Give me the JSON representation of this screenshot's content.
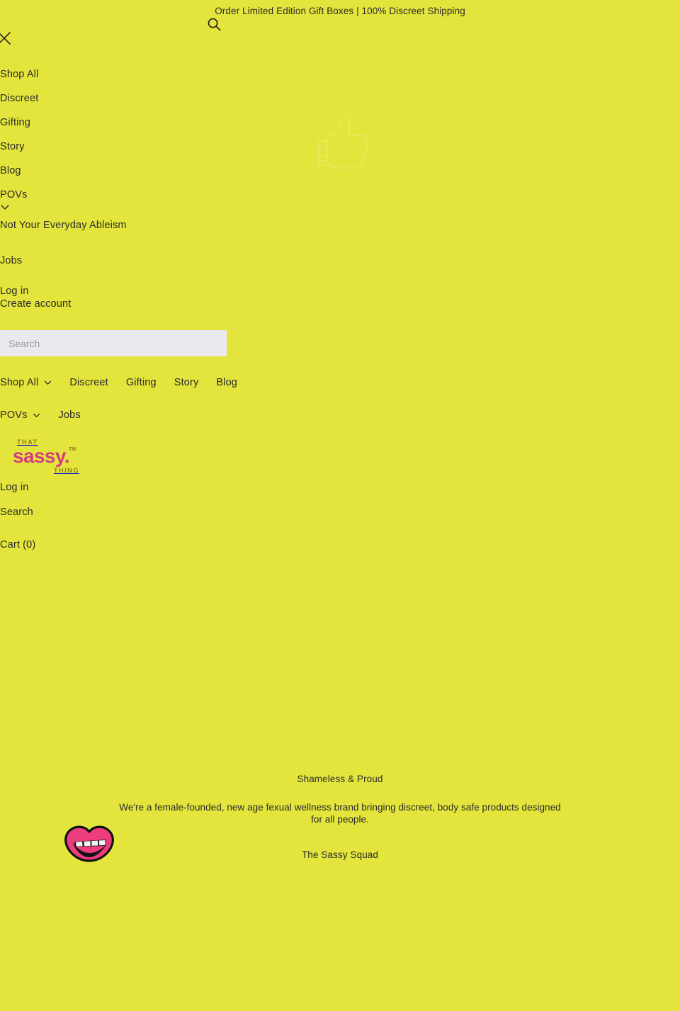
{
  "colors": {
    "background": "#e3e53c",
    "text": "#2b2b2b",
    "brand_pink": "#d63c80",
    "brand_olive": "#8f7f18",
    "search_field": "#ebe9f0",
    "placeholder": "#9a97a3"
  },
  "announcement": {
    "text": "Order Limited Edition Gift Boxes | 100% Discreet Shipping"
  },
  "drawer": {
    "close_label": "Close",
    "items": [
      {
        "label": "Shop All",
        "has_submenu": false
      },
      {
        "label": "Discreet",
        "has_submenu": false
      },
      {
        "label": "Gifting",
        "has_submenu": false
      },
      {
        "label": "Story",
        "has_submenu": false
      },
      {
        "label": "Blog",
        "has_submenu": false
      },
      {
        "label": "POVs",
        "has_submenu": true
      }
    ],
    "submenu": [
      {
        "label": "Not Your Everyday Ableism"
      }
    ],
    "jobs": {
      "label": "Jobs"
    }
  },
  "account": {
    "login_label": "Log in",
    "create_label": "Create account"
  },
  "search": {
    "placeholder": "Search",
    "value": "",
    "icon": "search-icon"
  },
  "nav": {
    "row1": [
      {
        "label": "Shop All",
        "caret": true
      },
      {
        "label": "Discreet",
        "caret": false
      },
      {
        "label": "Gifting",
        "caret": false
      },
      {
        "label": "Story",
        "caret": false
      },
      {
        "label": "Blog",
        "caret": false
      }
    ],
    "row2": [
      {
        "label": "POVs",
        "caret": true
      },
      {
        "label": "Jobs",
        "caret": false
      }
    ]
  },
  "logo": {
    "top_word": "THAT",
    "main_word": "sassy.",
    "trademark": "TM",
    "bottom_word": "THING"
  },
  "utility": {
    "login_label": "Log in",
    "search_label": "Search",
    "cart_label": "Cart (0)"
  },
  "footer": {
    "heading": "Shameless & Proud",
    "description": "We're a female-founded, new age fexual wellness brand bringing discreet, body safe products designed for all people.",
    "squad_label": "The Sassy Squad",
    "lips_icon": "lips-icon"
  },
  "watermark": {
    "icon": "thumbs-up-icon"
  }
}
